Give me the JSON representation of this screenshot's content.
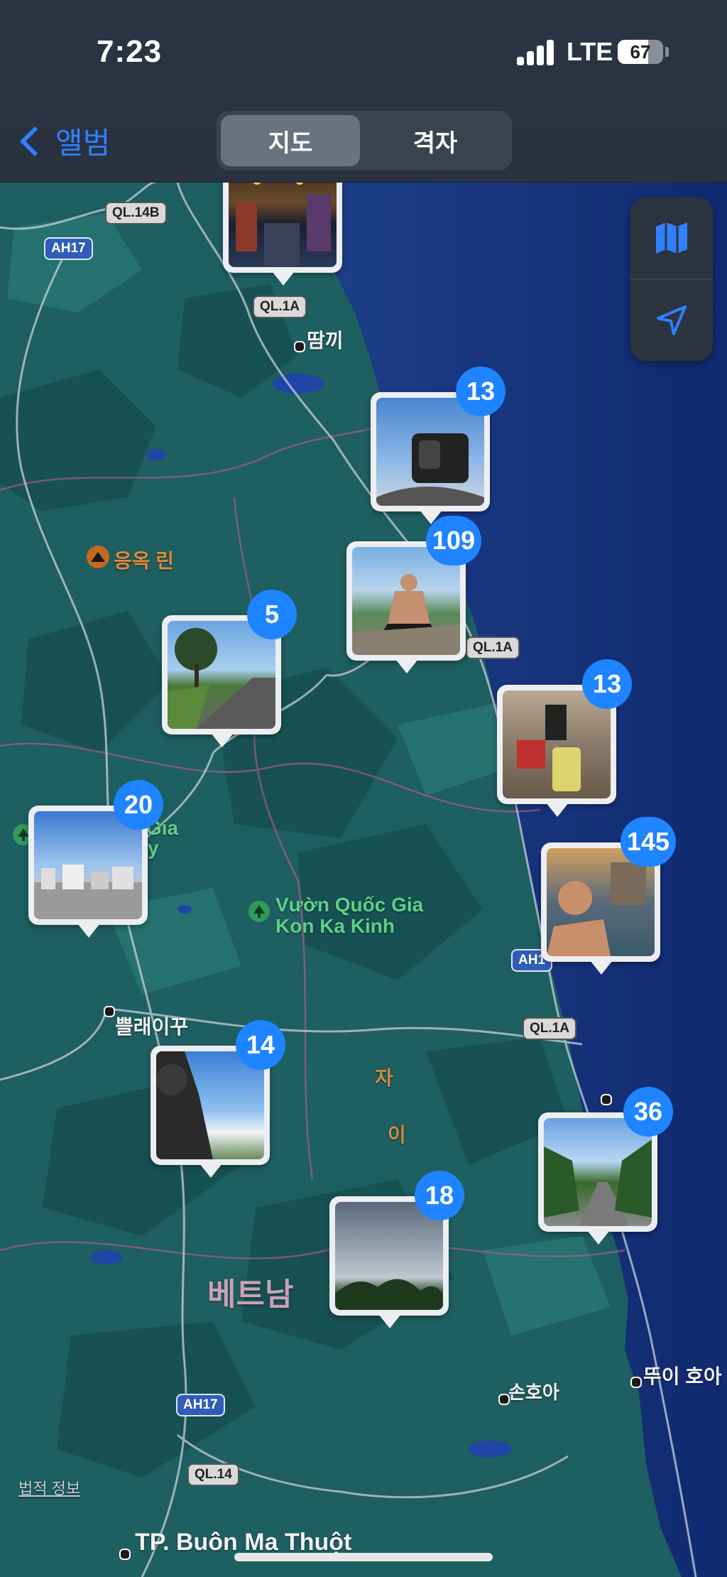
{
  "status": {
    "time": "7:23",
    "network": "LTE",
    "battery": "67",
    "battery_level": 0.67
  },
  "nav": {
    "back_label": "앨범",
    "segments": [
      "지도",
      "격자"
    ],
    "selected_segment": "지도"
  },
  "map": {
    "place_labels": {
      "dam_ki": "땀끼",
      "ngoc_linh": "응옥 린",
      "pleiku": "쁠래이꾸",
      "kon_ka_kinh_1": "Vườn Quốc Gia",
      "kon_ka_kinh_2": "Kon Ka Kinh",
      "partial_gia": "Gia",
      "partial_y": "y",
      "vietnam": "베트남",
      "son_hoa": "손호아",
      "tuy_hoa": "뚜이 호아",
      "buon_ma_thuot": "TP. Buôn Ma Thuột",
      "region_1": "자",
      "region_2": "이",
      "legal": "법적 정보"
    },
    "road_shields": {
      "ql14b": "QL.14B",
      "ah17_top": "AH17",
      "ql1a_top": "QL.1A",
      "ql1a_mid": "QL.1A",
      "ah1": "AH1",
      "ql1a_lower": "QL.1A",
      "ah17_bottom": "AH17",
      "ql14": "QL.14"
    },
    "controls": {
      "map_mode_icon": "map-icon",
      "location_icon": "location-arrow-icon"
    }
  },
  "photo_clusters": [
    {
      "id": "hoi-an",
      "count": "",
      "subject": "night street"
    },
    {
      "id": "coast-1",
      "count": "13",
      "subject": "phone mount"
    },
    {
      "id": "coast-2",
      "count": "109",
      "subject": "man meditating"
    },
    {
      "id": "highland-road",
      "count": "5",
      "subject": "road"
    },
    {
      "id": "coast-3",
      "count": "13",
      "subject": "cafe drink"
    },
    {
      "id": "city",
      "count": "20",
      "subject": "city skyline"
    },
    {
      "id": "coast-4",
      "count": "145",
      "subject": "swimming"
    },
    {
      "id": "pleiku-road",
      "count": "14",
      "subject": "helmet selfie"
    },
    {
      "id": "coast-5",
      "count": "36",
      "subject": "motorbike road"
    },
    {
      "id": "south",
      "count": "18",
      "subject": "cloudy sky trees"
    }
  ],
  "colors": {
    "accent": "#1e84ff",
    "land": "#1e5f61",
    "sea": "#14307a"
  }
}
